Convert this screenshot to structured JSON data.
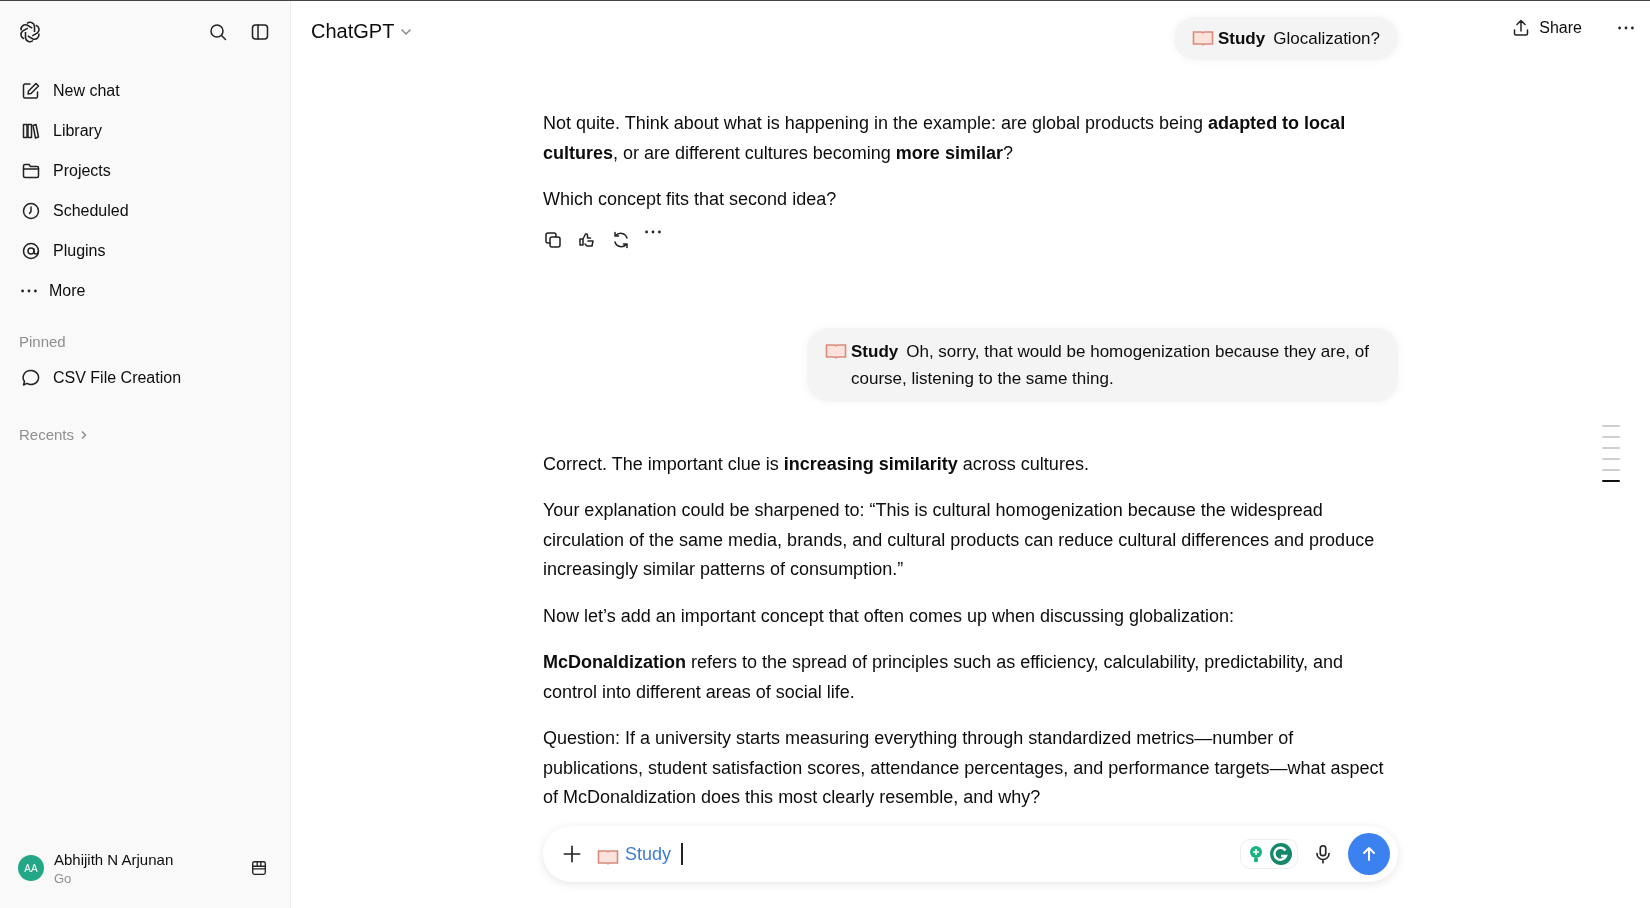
{
  "sidebar": {
    "nav": [
      {
        "kind": "compose",
        "label": "New chat"
      },
      {
        "kind": "library",
        "label": "Library"
      },
      {
        "kind": "folder",
        "label": "Projects"
      },
      {
        "kind": "clock",
        "label": "Scheduled"
      },
      {
        "kind": "at",
        "label": "Plugins"
      },
      {
        "kind": "dots",
        "label": "More"
      }
    ],
    "pinned_heading": "Pinned",
    "pinned": [
      {
        "label": "CSV File Creation"
      }
    ],
    "recents": "Recents",
    "user": {
      "initials": "AA",
      "name": "Abhijith N Arjunan",
      "plan": "Go"
    }
  },
  "header": {
    "title": "ChatGPT",
    "share": "Share"
  },
  "messages": [
    {
      "kind": "user",
      "tag": "Study",
      "text": "Glocalization?",
      "sticky": true
    },
    {
      "kind": "assistant",
      "paragraphs": [
        "Not quite. Think about what is happening in the example: are global products being **adapted to local cultures**, or are different cultures becoming **more similar**?",
        "Which concept fits that second idea?"
      ],
      "actions": true
    },
    {
      "kind": "user",
      "tag": "Study",
      "text": "Oh, sorry, that would be homogenization because they are, of course, listening to the same thing.",
      "sticky": false
    },
    {
      "kind": "assistant",
      "paragraphs": [
        "Correct. The important clue is **increasing similarity** across cultures.",
        "Your explanation could be sharpened to: “This is cultural homogenization because the widespread circulation of the same media, brands, and cultural products can reduce cultural differences and produce increasingly similar patterns of consumption.”",
        "Now let’s add an important concept that often comes up when discussing globalization:",
        "**McDonaldization** refers to the spread of principles such as efficiency, calculability, predictability, and control into different areas of social life.",
        "Question: If a university starts measuring everything through standardized metrics—number of publications, student satisfaction scores, attendance percentages, and performance targets—what aspect of McDonaldization does this most clearly resemble, and why?"
      ],
      "actions": false
    }
  ],
  "composer": {
    "tag": "Study"
  },
  "scroll_markers": [
    {
      "selected": false
    },
    {
      "selected": false
    },
    {
      "selected": false
    },
    {
      "selected": false
    },
    {
      "selected": false
    },
    {
      "selected": true
    }
  ]
}
